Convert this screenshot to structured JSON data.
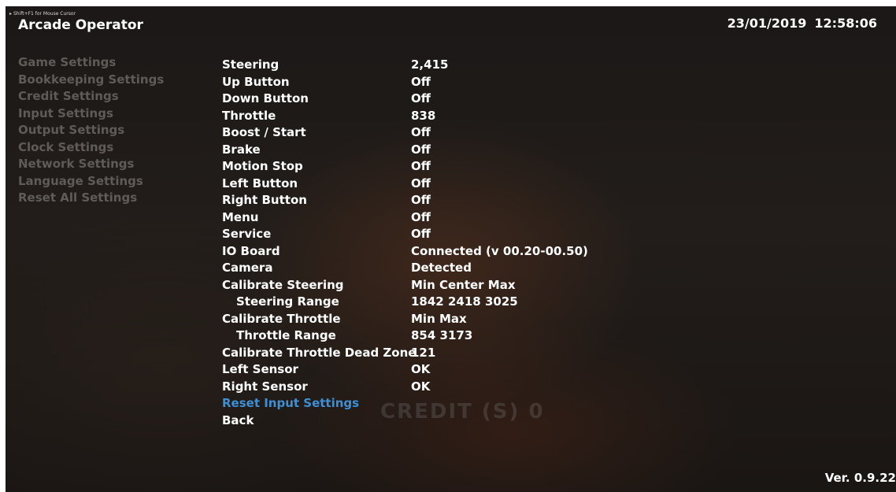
{
  "header": {
    "hint": "Shift+F1 for Mouse Cursor",
    "title": "Arcade Operator",
    "date": "23/01/2019",
    "time": "12:58:06"
  },
  "sidebar": {
    "items": [
      {
        "label": "Game Settings"
      },
      {
        "label": "Bookkeeping Settings"
      },
      {
        "label": "Credit Settings"
      },
      {
        "label": "Input Settings"
      },
      {
        "label": "Output Settings"
      },
      {
        "label": "Clock Settings"
      },
      {
        "label": "Network Settings"
      },
      {
        "label": "Language Settings"
      },
      {
        "label": "Reset All Settings"
      }
    ]
  },
  "inputs": {
    "rows": [
      {
        "label": "Steering",
        "value": "2,415"
      },
      {
        "label": "Up Button",
        "value": "Off"
      },
      {
        "label": "Down Button",
        "value": "Off"
      },
      {
        "label": "Throttle",
        "value": "838"
      },
      {
        "label": "Boost / Start",
        "value": "Off"
      },
      {
        "label": "Brake",
        "value": "Off"
      },
      {
        "label": "Motion Stop",
        "value": "Off"
      },
      {
        "label": "Left Button",
        "value": "Off"
      },
      {
        "label": "Right Button",
        "value": "Off"
      },
      {
        "label": "Menu",
        "value": "Off"
      },
      {
        "label": "Service",
        "value": "Off"
      },
      {
        "label": "IO Board",
        "value": "Connected (v 00.20-00.50)"
      },
      {
        "label": "Camera",
        "value": "Detected"
      },
      {
        "label": "Calibrate Steering",
        "value": "Min Center Max"
      },
      {
        "label": "Steering Range",
        "value": "1842 2418 3025"
      },
      {
        "label": "Calibrate Throttle",
        "value": "Min Max"
      },
      {
        "label": "Throttle Range",
        "value": "854 3173"
      },
      {
        "label": "Calibrate Throttle Dead Zone",
        "value": "121"
      },
      {
        "label": "Left Sensor",
        "value": "OK"
      },
      {
        "label": "Right Sensor",
        "value": "OK"
      }
    ],
    "reset_label": "Reset Input Settings",
    "back_label": "Back"
  },
  "background": {
    "credit_text": "CREDIT (S)  0"
  },
  "footer": {
    "version": "Ver. 0.9.22"
  },
  "colors": {
    "selected": "#3d8fd6",
    "inactive_menu": "#5f5b58",
    "text": "#ffffff"
  }
}
